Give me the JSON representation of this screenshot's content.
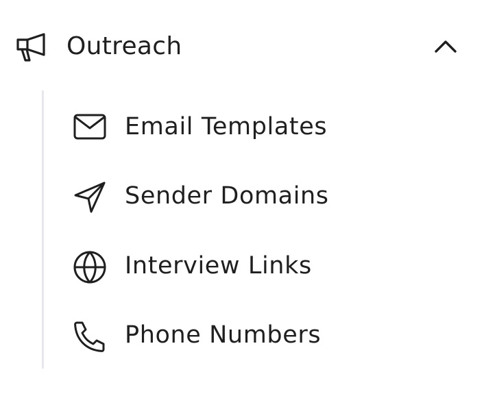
{
  "nav": {
    "group": {
      "label": "Outreach",
      "icon": "megaphone-icon",
      "expanded": true,
      "toggle_icon": "chevron-up-icon"
    },
    "items": [
      {
        "label": "Email Templates",
        "icon": "mail-icon"
      },
      {
        "label": "Sender Domains",
        "icon": "send-icon"
      },
      {
        "label": "Interview Links",
        "icon": "globe-icon"
      },
      {
        "label": "Phone Numbers",
        "icon": "phone-icon"
      }
    ]
  },
  "colors": {
    "text": "#1f1f1f",
    "rail": "#e6e6ec",
    "background": "#ffffff"
  }
}
